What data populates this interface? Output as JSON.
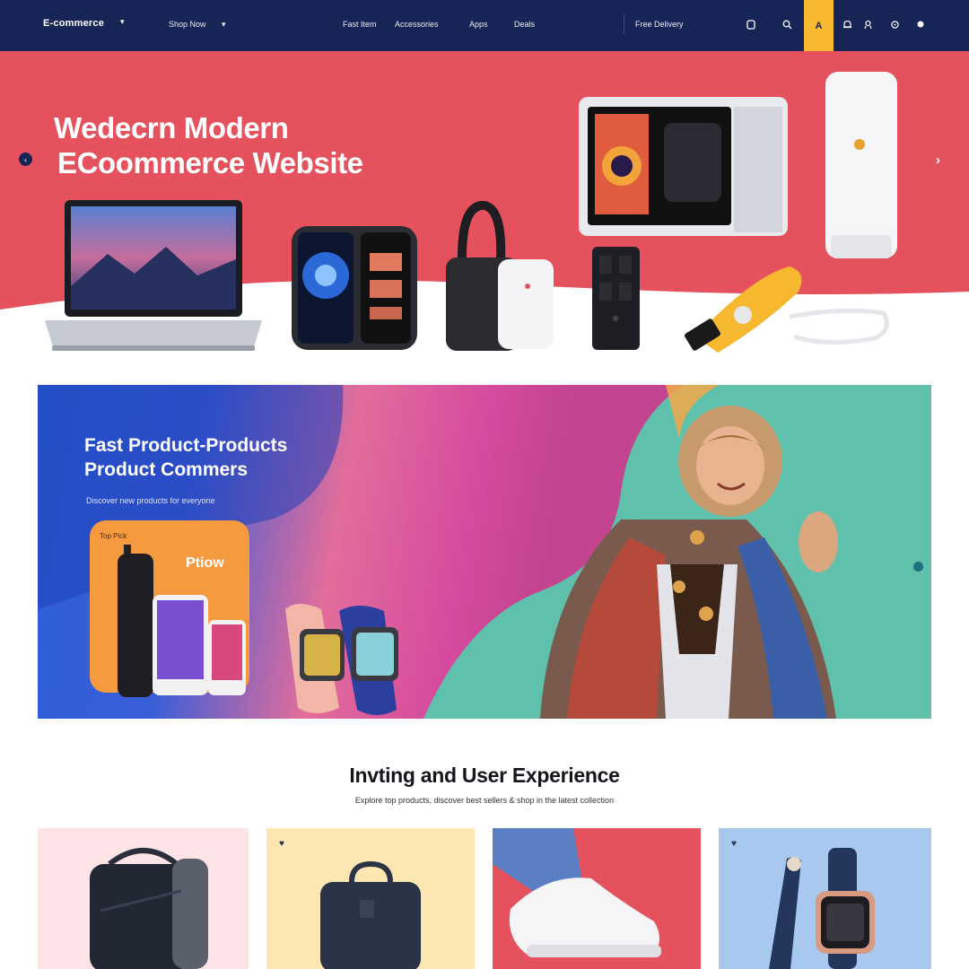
{
  "nav": {
    "logo": "E-commerce",
    "links": [
      "Shop Now",
      "Fast Item",
      "Accessories",
      "Apps",
      "Deals"
    ],
    "promo_text": "Free Delivery",
    "icons": [
      "user-icon",
      "search-icon",
      "cart-icon",
      "bell-icon",
      "heart-icon",
      "settings-icon"
    ],
    "cart_glyph": "A"
  },
  "hero": {
    "title_line1": "Wedecrn Modern",
    "title_line2": "ECoommerce Website",
    "prev_glyph": "‹",
    "next_glyph": "›"
  },
  "promo": {
    "title_line1": "Fast Product-Products",
    "title_line2": "Product Commers",
    "subtitle": "Discover new products for everyone",
    "card_tag": "Top Pick",
    "card_brand": "Ptiow"
  },
  "section": {
    "title": "Invting and User Experience",
    "subtitle": "Explore top products, discover best sellers & shop in the latest collection"
  },
  "products": [
    {
      "name": "Backpack",
      "bg": "#fbe3e6"
    },
    {
      "name": "Bag",
      "bg": "#fce7b3"
    },
    {
      "name": "Sneaker",
      "bg": "#e5525d"
    },
    {
      "name": "Watch",
      "bg": "#a7c8ef"
    }
  ],
  "colors": {
    "nav": "#172456",
    "accent": "#f7b92f",
    "hero": "#e5525d",
    "teal": "#5fc1ac"
  }
}
